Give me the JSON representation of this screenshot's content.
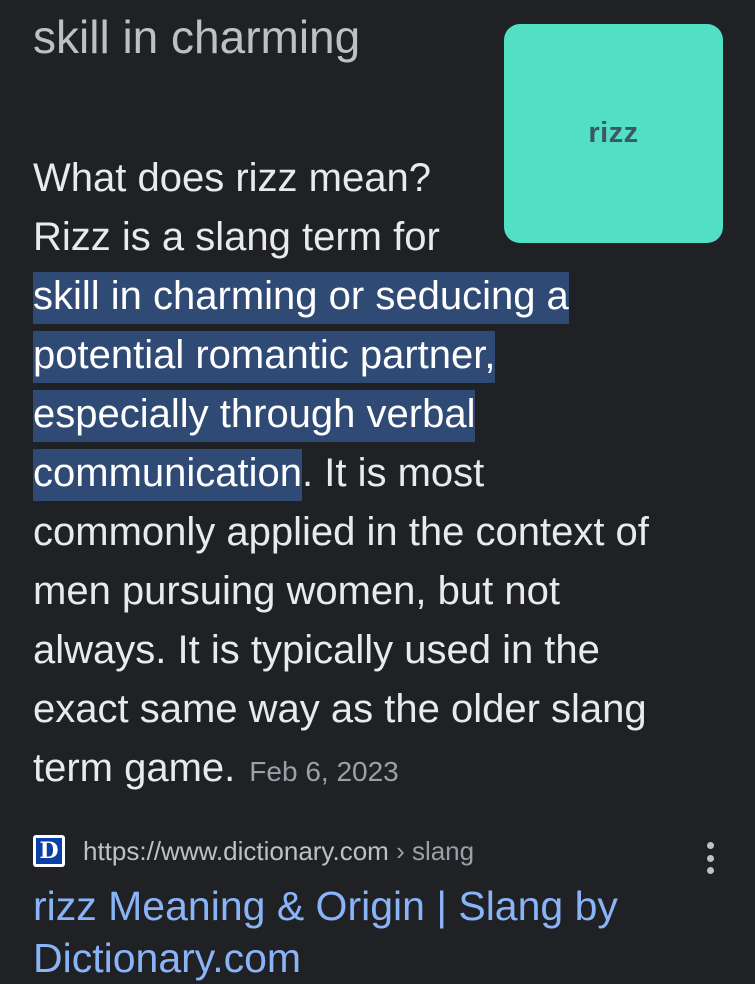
{
  "snippet": {
    "heading": "skill in charming",
    "thumbnail_label": "rizz",
    "thumbnail_color": "#52e0c4",
    "question": "What does rizz mean?",
    "intro": "Rizz is a slang term for",
    "highlight_lines": [
      "skill in charming or seducing a",
      "potential romantic partner,",
      "especially through verbal",
      "communication"
    ],
    "continuation": ". It is most",
    "rest_lines": [
      "commonly applied in the context of",
      "men pursuing women, but not",
      "always. It is typically used in the",
      "exact same way as the older slang"
    ],
    "last_line": "term game.",
    "date": "Feb 6, 2023"
  },
  "source": {
    "favicon_letter": "D",
    "url": "https://www.dictionary.com",
    "breadcrumb": " › slang"
  },
  "result": {
    "title_lines": [
      "rizz Meaning & Origin | Slang by",
      "Dictionary.com"
    ]
  },
  "colors": {
    "background": "#202124",
    "highlight": "#2f4a75",
    "link": "#8ab4f8"
  }
}
